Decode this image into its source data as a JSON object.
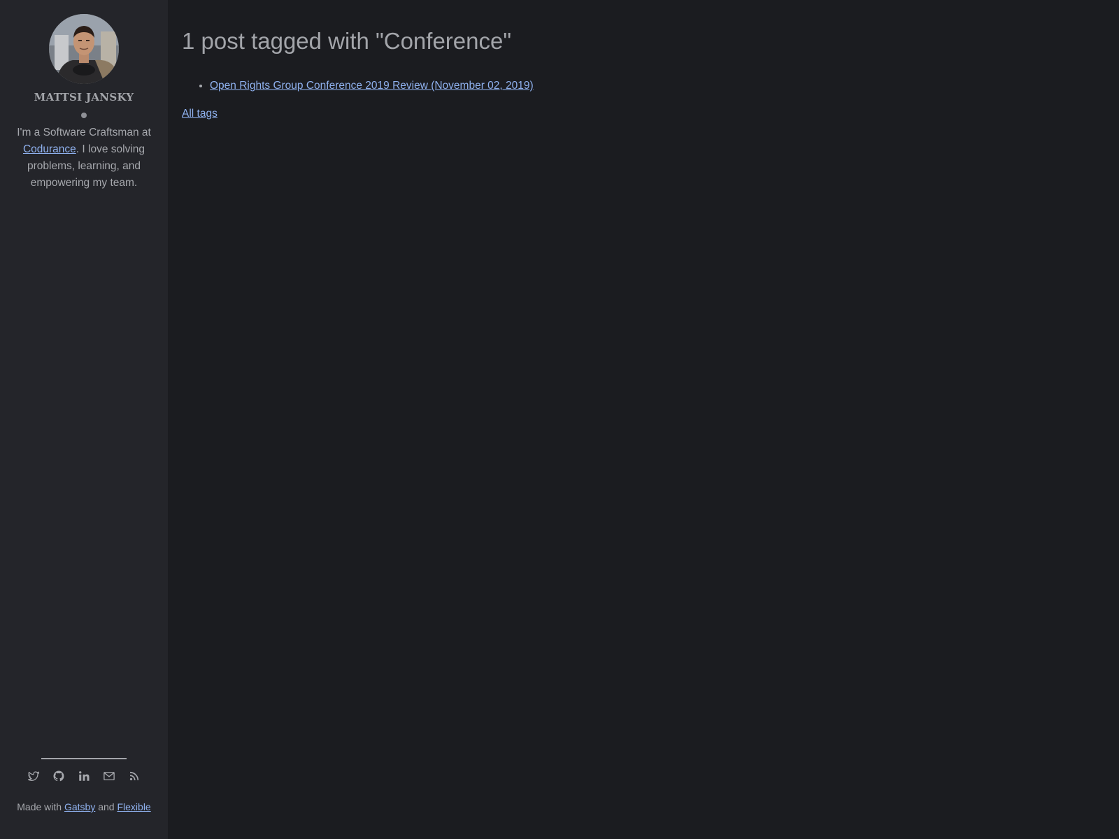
{
  "sidebar": {
    "author_name": "MATTSI JANSKY",
    "bio_before": "I'm a Software Craftsman at ",
    "bio_link": "Codurance",
    "bio_after": ". I love solving problems, learning, and empowering my team.",
    "social_icons": [
      "twitter-icon",
      "github-icon",
      "linkedin-icon",
      "email-icon",
      "rss-icon"
    ],
    "footer": {
      "made_with": "Made with ",
      "gatsby": "Gatsby",
      "and": " and ",
      "flexible": "Flexible"
    }
  },
  "main": {
    "title": "1 post tagged with \"Conference\"",
    "posts": [
      {
        "label": "Open Rights Group Conference 2019 Review (November 02, 2019)"
      }
    ],
    "all_tags": "All tags"
  },
  "colors": {
    "page_bg": "#1b1c20",
    "sidebar_bg": "#24252a",
    "text": "#a6a8ad",
    "link": "#8fb1ee"
  }
}
